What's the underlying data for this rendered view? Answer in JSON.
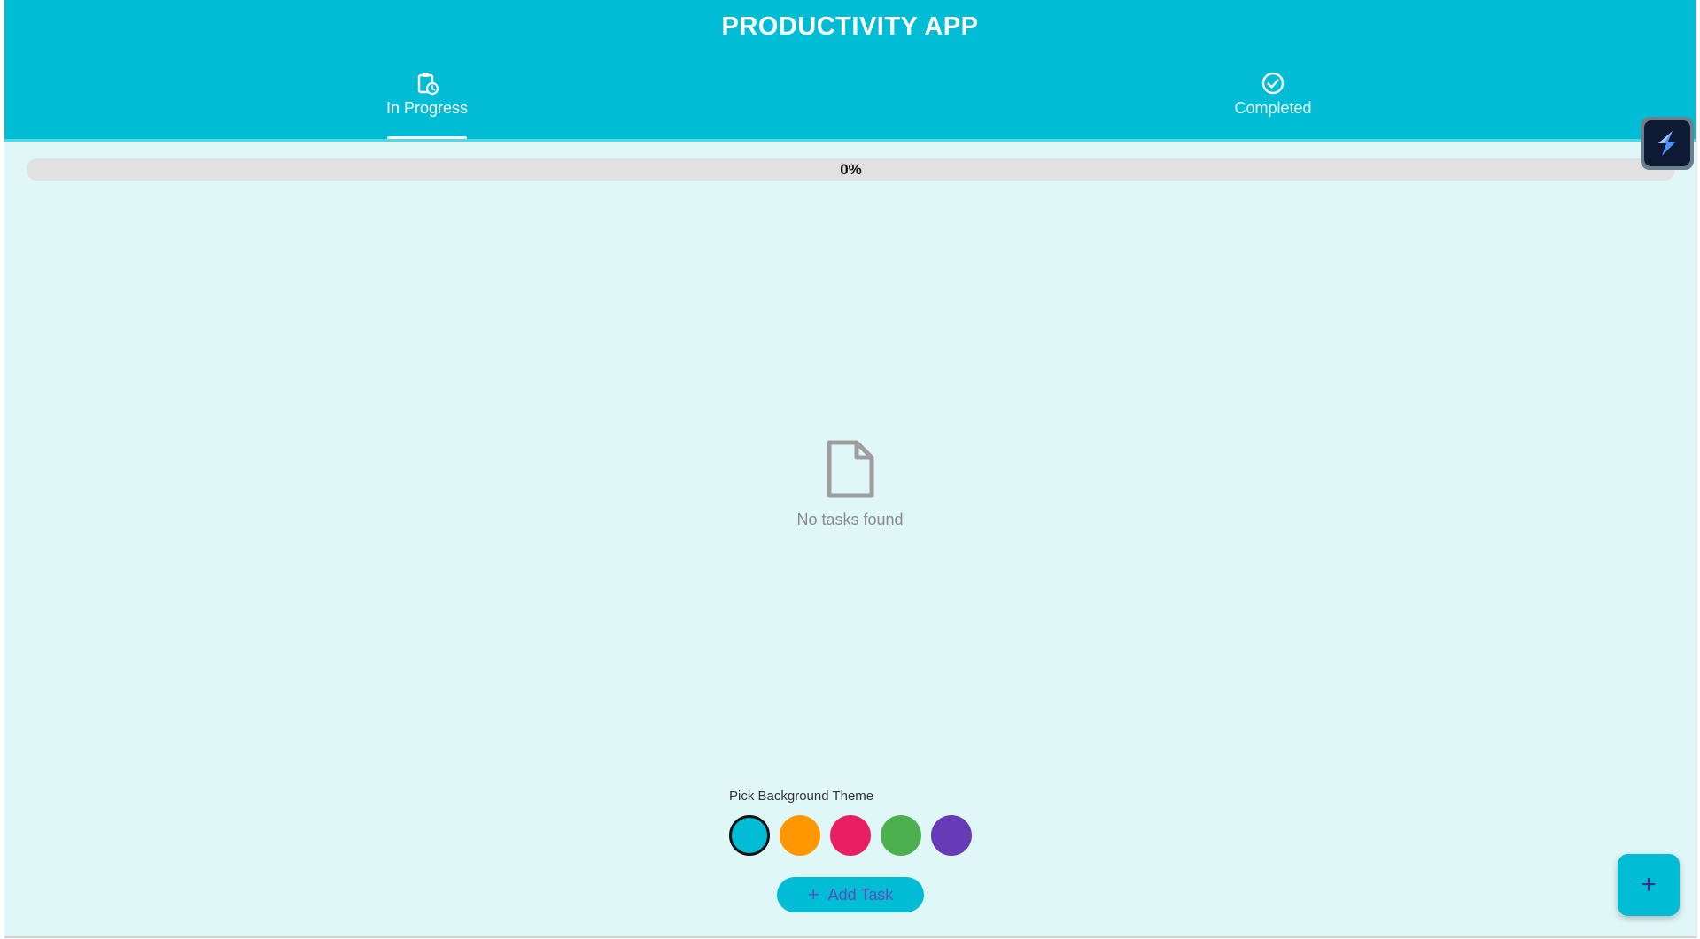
{
  "app": {
    "title": "PRODUCTIVITY APP"
  },
  "tabs": [
    {
      "label": "In Progress",
      "icon": "clipboard-clock-icon",
      "active": true
    },
    {
      "label": "Completed",
      "icon": "check-circle-icon",
      "active": false
    }
  ],
  "progress": {
    "value": 0,
    "label": "0%"
  },
  "empty_state": {
    "icon": "document-icon",
    "message": "No tasks found"
  },
  "theme_picker": {
    "label": "Pick Background Theme",
    "swatches": [
      {
        "name": "cyan",
        "color": "#00bcd4",
        "selected": true
      },
      {
        "name": "orange",
        "color": "#ff9800",
        "selected": false
      },
      {
        "name": "pink",
        "color": "#e91e63",
        "selected": false
      },
      {
        "name": "green",
        "color": "#4caf50",
        "selected": false
      },
      {
        "name": "purple",
        "color": "#673ab7",
        "selected": false
      }
    ]
  },
  "add_task_button": {
    "icon": "plus-icon",
    "label": "Add Task"
  },
  "fab": {
    "icon": "plus-icon",
    "symbol": "+"
  },
  "extension_badge": {
    "icon": "lightning-bolt-icon"
  },
  "colors": {
    "primary": "#00bcd4",
    "background": "#e0f7f8",
    "progress_track": "#e1e1e1",
    "muted_text": "#8a8a8a"
  }
}
